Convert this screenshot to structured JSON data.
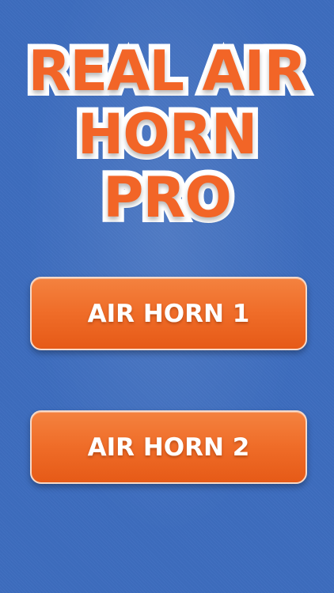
{
  "app": {
    "title_lines": [
      "REAL AIR",
      "HORN",
      "PRO"
    ]
  },
  "buttons": [
    {
      "label": "AIR HORN 1"
    },
    {
      "label": "AIR HORN 2"
    }
  ],
  "colors": {
    "background": "#3d6dbf",
    "title_fill": "#f26527",
    "title_outline": "#ffffff",
    "button_fill": "#ef6c28",
    "button_text": "#ffffff"
  }
}
